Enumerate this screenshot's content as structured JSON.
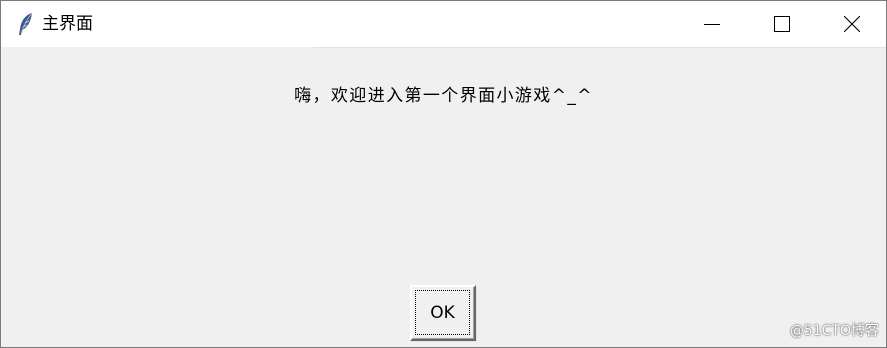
{
  "window": {
    "title": "主界面",
    "icon": "feather-icon"
  },
  "caption_buttons": {
    "minimize": "minimize-icon",
    "maximize": "maximize-icon",
    "close": "close-icon"
  },
  "content": {
    "message": "嗨，欢迎进入第一个界面小游戏^_^",
    "ok_label": "OK"
  },
  "watermark": "@51CTO博客",
  "colors": {
    "client_background": "#f0f0f0",
    "titlebar_background": "#ffffff"
  }
}
